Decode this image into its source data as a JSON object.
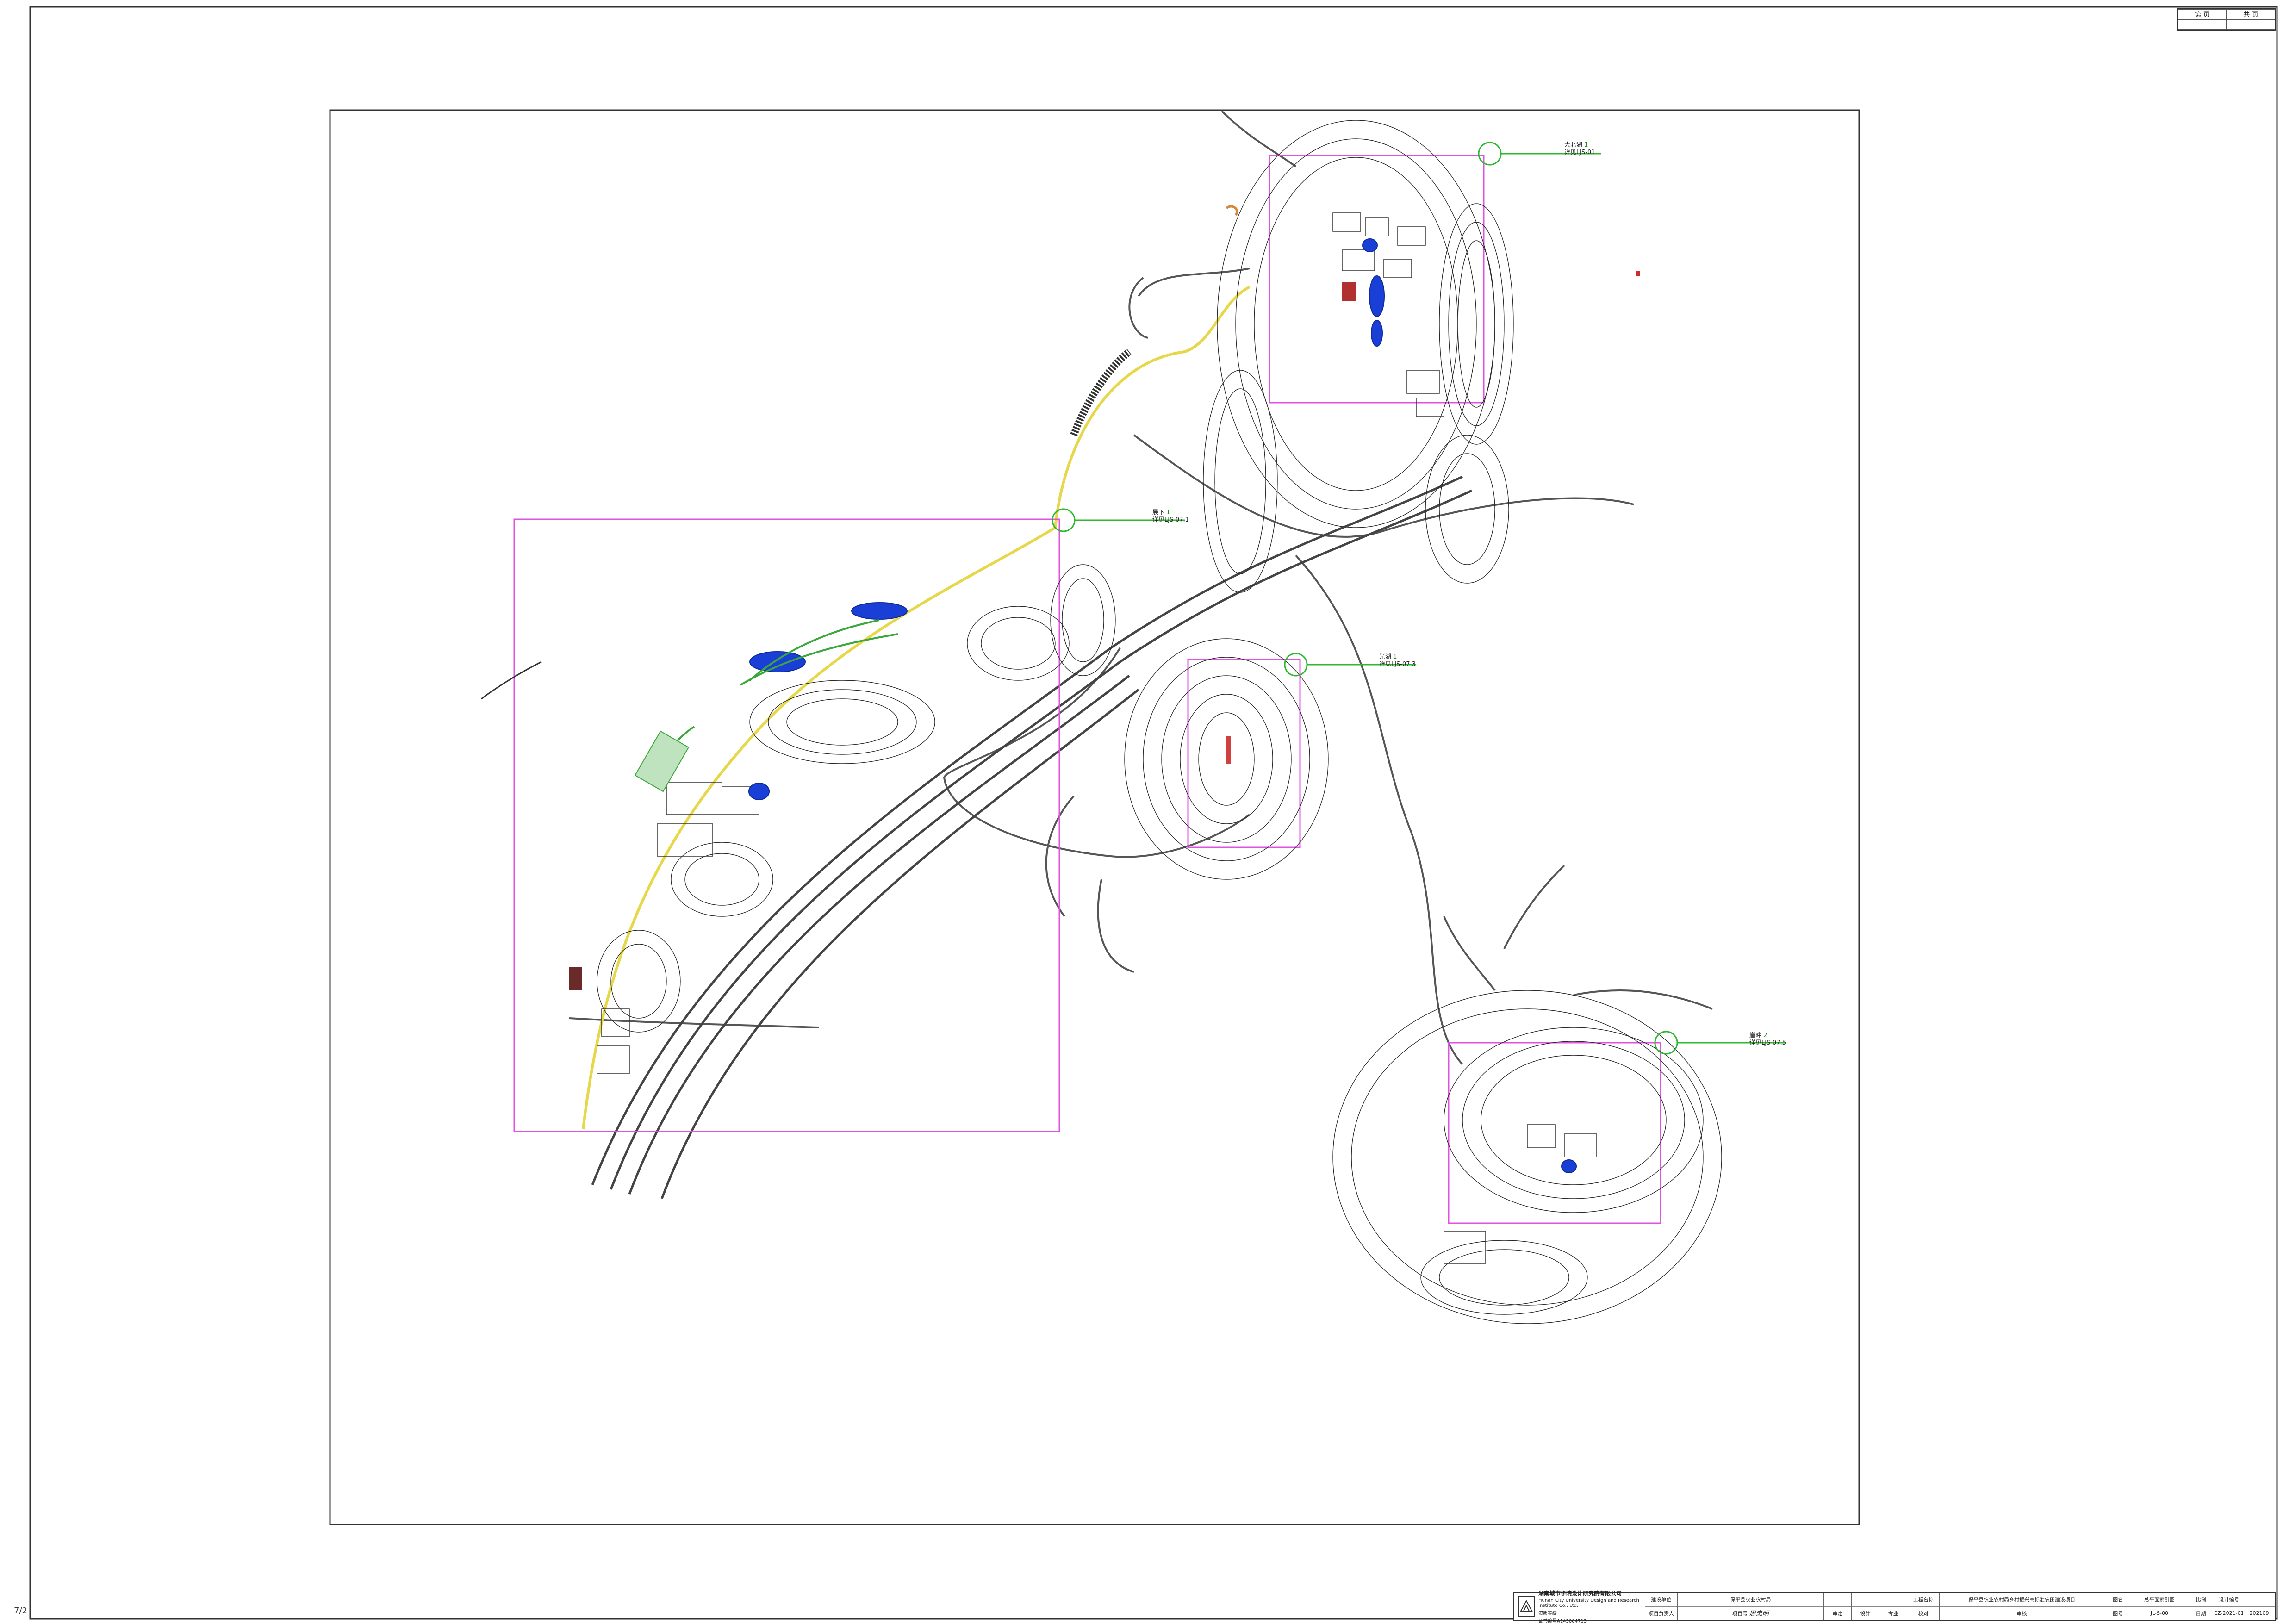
{
  "corner_box": {
    "labels": [
      "第 页",
      "共 页",
      "",
      ""
    ]
  },
  "callouts": [
    {
      "name": "大北湖",
      "number": "1",
      "ref": "详见LJS-01"
    },
    {
      "name": "展下",
      "number": "1",
      "ref": "详见LJS-07.1"
    },
    {
      "name": "光湖",
      "number": "1",
      "ref": "详见LJS-07.3"
    },
    {
      "name": "崖畔",
      "number": "2",
      "ref": "详见LJS-07.5"
    }
  ],
  "title_block": {
    "company_cn": "湖南城市学院设计研究院有限公司",
    "company_en": "Hunan City University Design and Research Institute Co., Ltd.",
    "cert_label": "资质等级",
    "cert_no": "证书编号A143004713",
    "col1": [
      "建设单位",
      "项目负责人"
    ],
    "col2": [
      "保平县农业农村局",
      "项目号"
    ],
    "col3": [
      "",
      "审定"
    ],
    "col4": [
      "",
      "设计"
    ],
    "col5": [
      "",
      "专业"
    ],
    "col6": [
      "工程名称",
      "校对"
    ],
    "col7": [
      "保平县农业农村局乡村振兴高标准农田建设项目",
      "审核"
    ],
    "col8": [
      "图名",
      "图号"
    ],
    "col9": [
      "总平面索引图",
      "JL-S-00"
    ],
    "col10": [
      "比例",
      "日期"
    ],
    "col11": [
      "设计编号",
      "CZ-2021-01"
    ],
    "col12": [
      "",
      "202109"
    ],
    "signature": "周忠明"
  },
  "side_mark": "7/2",
  "colors": {
    "frame": "#333333",
    "index_box": "#e052e0",
    "callout_line": "#2fb82f",
    "contour": "#2a2a2a",
    "road": "#555555",
    "water": "#1a3fd6",
    "greenbelt": "#3aa83a",
    "pathway": "#e6d84a"
  }
}
